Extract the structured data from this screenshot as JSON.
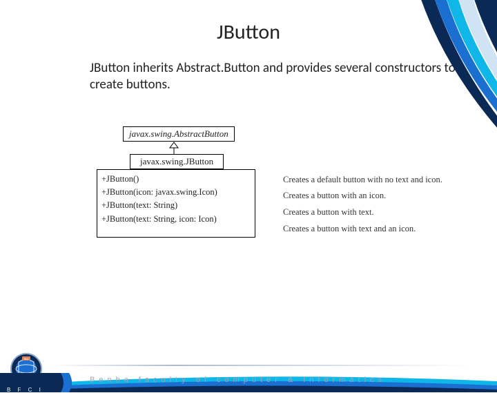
{
  "title": "JButton",
  "body": "JButton inherits Abstract.Button and provides several constructors to create buttons.",
  "uml": {
    "abstract_class": "javax.swing.AbstractButton",
    "class_name": "javax.swing.JButton",
    "rows": [
      {
        "signature": "+JButton()",
        "desc": "Creates a default button with no text and icon."
      },
      {
        "signature": "+JButton(icon: javax.swing.Icon)",
        "desc": "Creates a button with an icon."
      },
      {
        "signature": "+JButton(text: String)",
        "desc": "Creates a button with text."
      },
      {
        "signature": "+JButton(text: String, icon: Icon)",
        "desc": "Creates a button with text and an icon."
      }
    ]
  },
  "footer": {
    "bfci": "B F C I",
    "text": "Benha faculty of computer & Informatics"
  }
}
